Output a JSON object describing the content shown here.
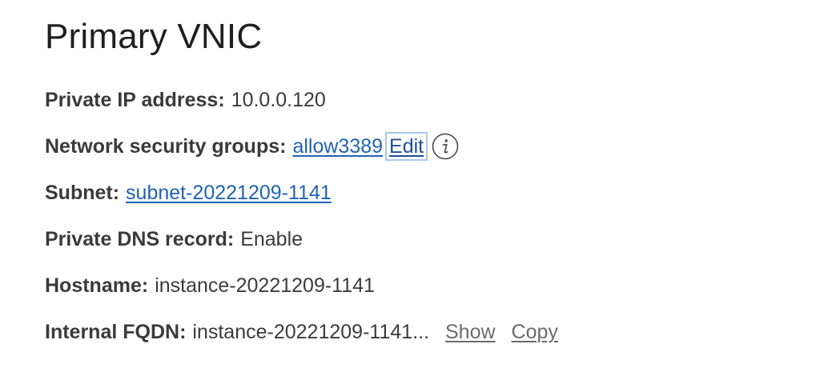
{
  "section": {
    "title": "Primary VNIC"
  },
  "rows": {
    "private_ip": {
      "label": "Private IP address:",
      "value": "10.0.0.120"
    },
    "nsg": {
      "label": "Network security groups:",
      "link": "allow3389",
      "edit": "Edit",
      "info_icon": "info-icon"
    },
    "subnet": {
      "label": "Subnet:",
      "link": "subnet-20221209-1141"
    },
    "dns": {
      "label": "Private DNS record:",
      "value": "Enable"
    },
    "hostname": {
      "label": "Hostname:",
      "value": "instance-20221209-1141"
    },
    "fqdn": {
      "label": "Internal FQDN:",
      "value": "instance-20221209-1141...",
      "show": "Show",
      "copy": "Copy"
    }
  },
  "colors": {
    "link": "#1f62b5",
    "text": "#3b3b3b",
    "muted_link": "#6a6a6a",
    "focus_outline": "#a9c6ea"
  }
}
